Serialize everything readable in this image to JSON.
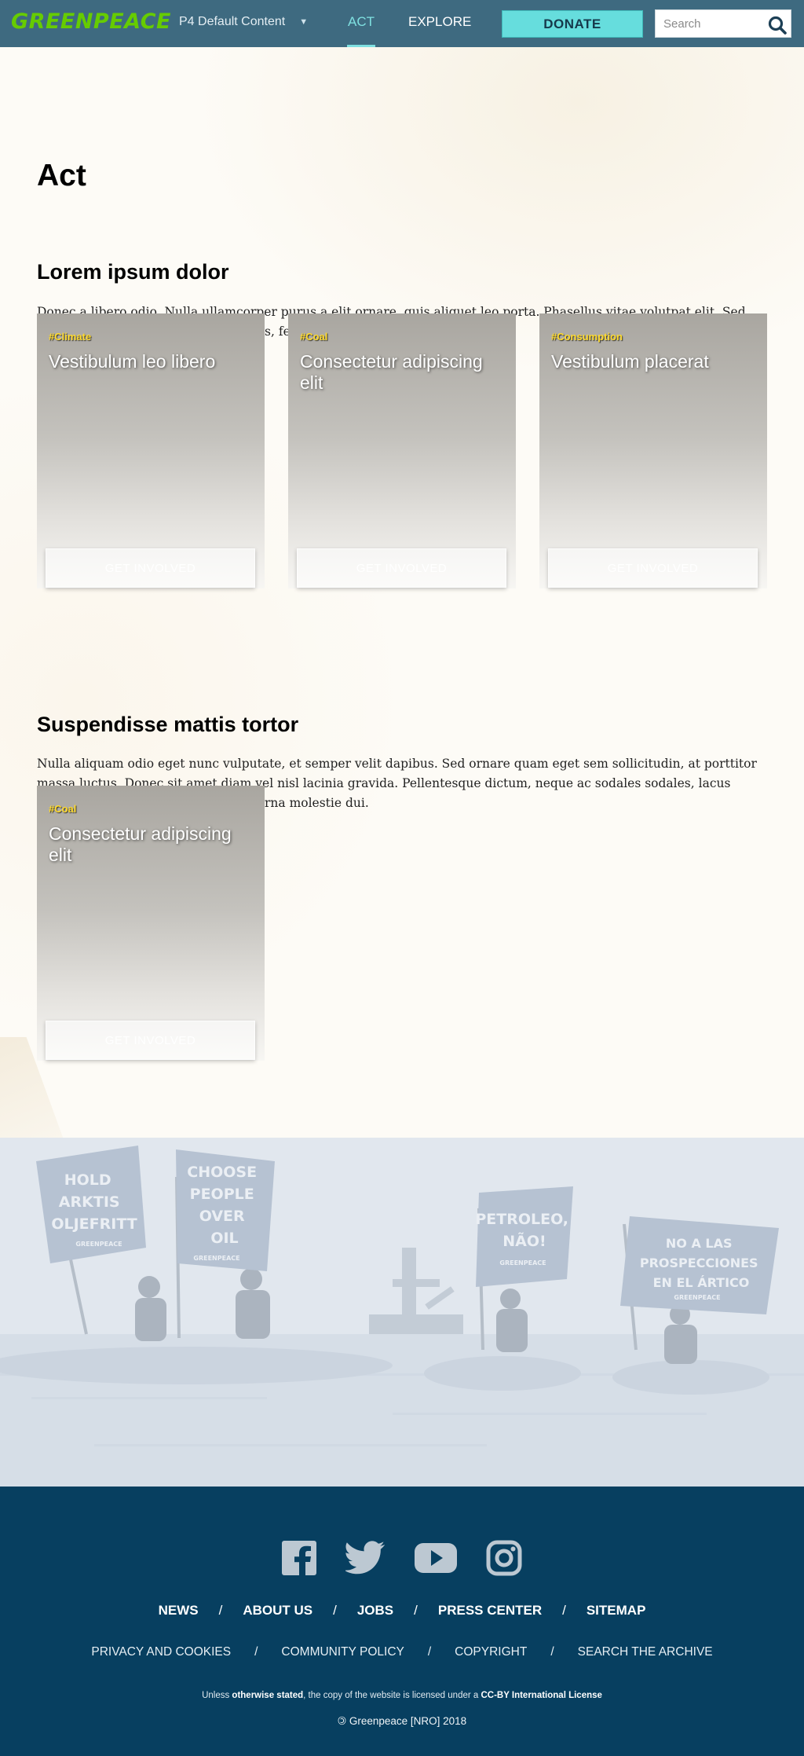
{
  "header": {
    "logo": "GREENPEACE",
    "site_selector": "P4 Default Content",
    "nav": [
      "ACT",
      "EXPLORE"
    ],
    "donate": "DONATE",
    "search_placeholder": "Search",
    "colors": {
      "bar": "#3e6a80",
      "accent": "#66dddd",
      "logo": "#66cc00"
    }
  },
  "page": {
    "title": "Act"
  },
  "sections": [
    {
      "title": "Lorem ipsum dolor",
      "text": "Donec a libero odio. Nulla ullamcorper purus a elit ornare, quis aliquet leo porta. Phasellus vitae volutpat elit. Sed massa elit, rhoncus non pharetra quis, feugiat sollicitudin magna.",
      "cards": [
        {
          "tag": "#Climate",
          "title": "Vestibulum leo libero",
          "button": "GET INVOLVED"
        },
        {
          "tag": "#Coal",
          "title": "Consectetur adipiscing elit",
          "button": "GET INVOLVED"
        },
        {
          "tag": "#Consumption",
          "title": "Vestibulum placerat",
          "button": "GET INVOLVED"
        }
      ]
    },
    {
      "title": "Suspendisse mattis tortor",
      "text": "Nulla aliquam odio eget nunc vulputate, et semper velit dapibus. Sed ornare quam eget sem sollicitudin, at porttitor massa luctus. Donec sit amet diam vel nisl lacinia gravida. Pellentesque dictum, neque ac sodales sodales, lacus massa blandit felis, at gravida odio urna molestie dui.",
      "cards": [
        {
          "tag": "#Coal",
          "title": "Consectetur adipiscing elit",
          "button": "GET INVOLVED"
        }
      ]
    }
  ],
  "photo": {
    "banners": [
      [
        "HOLD",
        "ARKTIS",
        "OLJEFRITT"
      ],
      [
        "CHOOSE",
        "PEOPLE",
        "OVER",
        "OIL"
      ],
      [
        "PETROLEO,",
        "NÃO!"
      ],
      [
        "NO A LAS",
        "PROSPECCIONES",
        "EN EL ÁRTICO"
      ]
    ],
    "banner_logo": "GREENPEACE"
  },
  "footer": {
    "social": [
      "facebook-icon",
      "twitter-icon",
      "youtube-icon",
      "instagram-icon"
    ],
    "main_links": [
      "NEWS",
      "ABOUT US",
      "JOBS",
      "PRESS CENTER",
      "SITEMAP"
    ],
    "sub_links": [
      "PRIVACY AND COOKIES",
      "COMMUNITY POLICY",
      "COPYRIGHT",
      "SEARCH THE ARCHIVE"
    ],
    "separator": "/",
    "license_pre": "Unless ",
    "license_link1": "otherwise stated",
    "license_mid": ", the copy of the website is licensed under a ",
    "license_link2": "CC-BY International License",
    "copyright": "Greenpeace [NRO] 2018",
    "copyright_symbol": "🄯",
    "colors": {
      "background": "#073f60"
    }
  }
}
